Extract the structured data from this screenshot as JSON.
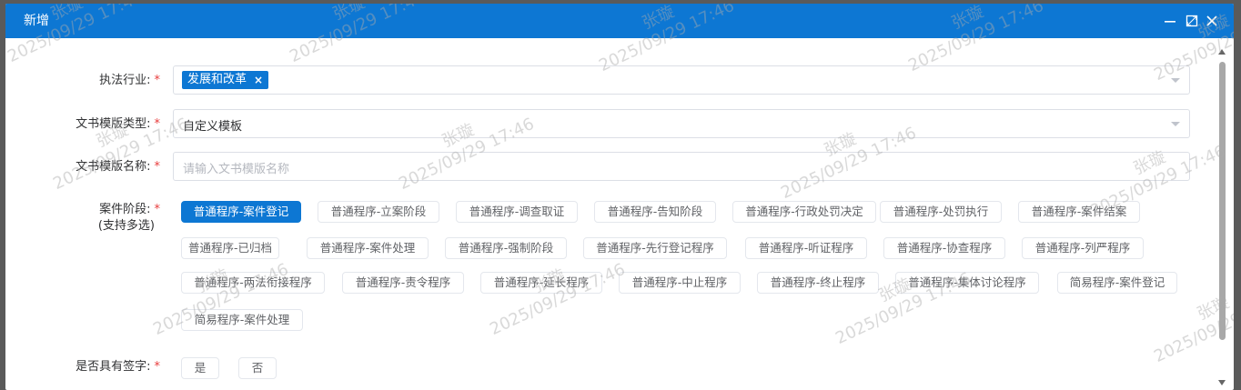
{
  "dialog": {
    "title": "新增",
    "controls": [
      "minimize-icon",
      "maximize-icon",
      "close-icon"
    ]
  },
  "form": {
    "industry": {
      "label": "执法行业:",
      "required": "*",
      "tags": [
        "发展和改革"
      ],
      "tag_remove": "×"
    },
    "template_type": {
      "label": "文书模版类型:",
      "required": "*",
      "value": "自定义模板"
    },
    "template_name": {
      "label": "文书模版名称:",
      "required": "*",
      "placeholder": "请输入文书模版名称"
    },
    "case_stage": {
      "label": "案件阶段:",
      "required": "*",
      "sub_label": "(支持多选)",
      "options": [
        "普通程序-案件登记",
        "普通程序-立案阶段",
        "普通程序-调查取证",
        "普通程序-告知阶段",
        "普通程序-行政处罚决定",
        "普通程序-处罚执行",
        "普通程序-案件结案",
        "普通程序-已归档",
        "普通程序-案件处理",
        "普通程序-强制阶段",
        "普通程序-先行登记程序",
        "普通程序-听证程序",
        "普通程序-协查程序",
        "普通程序-列严程序",
        "普通程序-两法衔接程序",
        "普通程序-责令程序",
        "普通程序-延长程序",
        "普通程序-中止程序",
        "普通程序-终止程序",
        "普通程序-集体讨论程序",
        "简易程序-案件登记",
        "简易程序-案件处理"
      ],
      "selected": "普通程序-案件登记"
    },
    "has_signature": {
      "label": "是否具有签字:",
      "required": "*",
      "options": [
        "是",
        "否"
      ]
    }
  },
  "watermark": {
    "name": "张璇",
    "datetime": "2025/09/29 17:46"
  },
  "colors": {
    "primary": "#0d77d3",
    "required": "#e83c3c"
  }
}
